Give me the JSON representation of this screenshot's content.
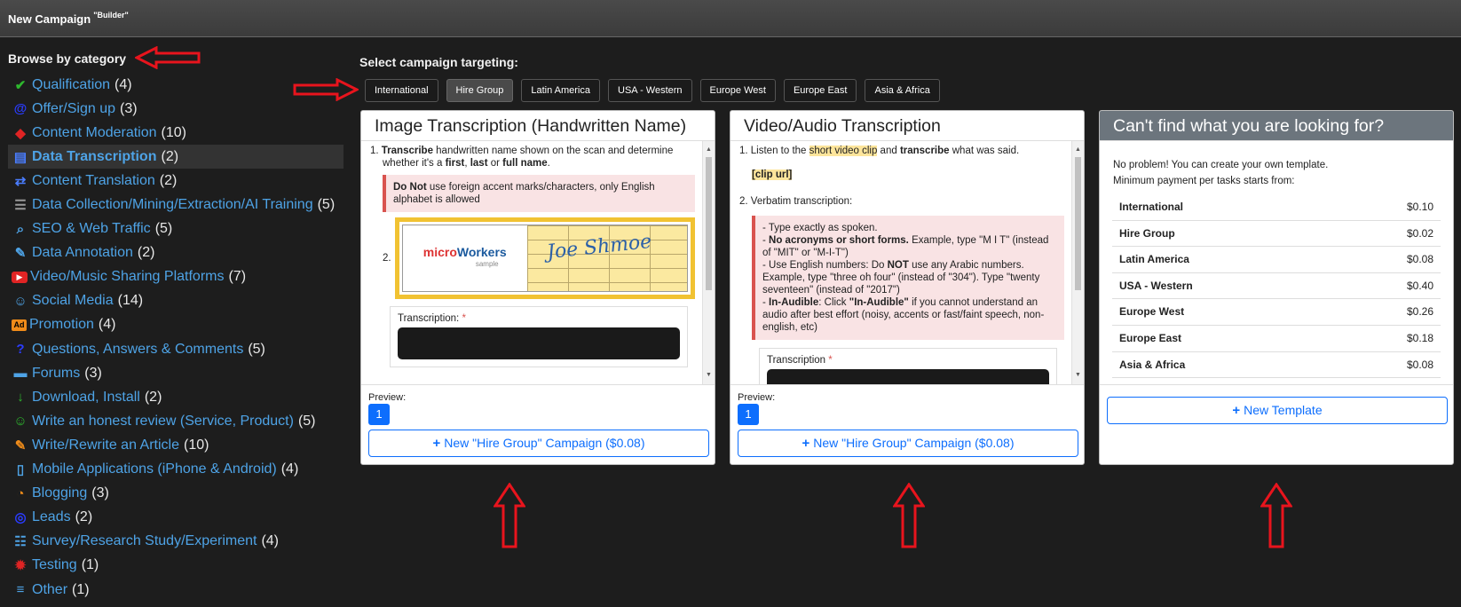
{
  "header": {
    "title": "New Campaign",
    "badge": "\"Builder\""
  },
  "sidebar": {
    "heading": "Browse by category",
    "items": [
      {
        "label": "Qualification",
        "count": "(4)",
        "icon": "user-check-icon",
        "color": "#2eb82e"
      },
      {
        "label": "Offer/Sign up",
        "count": "(3)",
        "icon": "at-sign-icon",
        "color": "#2a3cff"
      },
      {
        "label": "Content Moderation",
        "count": "(10)",
        "icon": "shield-icon",
        "color": "#e02424"
      },
      {
        "label": "Data Transcription",
        "count": "(2)",
        "icon": "file-audio-icon",
        "color": "#4a7dff"
      },
      {
        "label": "Content Translation",
        "count": "(2)",
        "icon": "translate-icon",
        "color": "#4a7dff"
      },
      {
        "label": "Data Collection/Mining/Extraction/AI Training",
        "count": "(5)",
        "icon": "document-icon",
        "color": "#999999"
      },
      {
        "label": "SEO & Web Traffic",
        "count": "(5)",
        "icon": "search-icon",
        "color": "#4ea3e6"
      },
      {
        "label": "Data Annotation",
        "count": "(2)",
        "icon": "edit-note-icon",
        "color": "#4ea3e6"
      },
      {
        "label": "Video/Music Sharing Platforms",
        "count": "(7)",
        "icon": "youtube-icon",
        "color": "#e02424"
      },
      {
        "label": "Social Media",
        "count": "(14)",
        "icon": "users-icon",
        "color": "#4ea3e6"
      },
      {
        "label": "Promotion",
        "count": "(4)",
        "icon": "ad-icon",
        "color": "#f08c1a"
      },
      {
        "label": "Questions, Answers & Comments",
        "count": "(5)",
        "icon": "question-icon",
        "color": "#2a3cff"
      },
      {
        "label": "Forums",
        "count": "(3)",
        "icon": "comments-icon",
        "color": "#4ea3e6"
      },
      {
        "label": "Download, Install",
        "count": "(2)",
        "icon": "download-icon",
        "color": "#2eb82e"
      },
      {
        "label": "Write an honest review (Service, Product)",
        "count": "(5)",
        "icon": "smile-icon",
        "color": "#2eb82e"
      },
      {
        "label": "Write/Rewrite an Article",
        "count": "(10)",
        "icon": "pencil-icon",
        "color": "#f08c1a"
      },
      {
        "label": "Mobile Applications (iPhone & Android)",
        "count": "(4)",
        "icon": "mobile-icon",
        "color": "#4ea3e6"
      },
      {
        "label": "Blogging",
        "count": "(3)",
        "icon": "rss-icon",
        "color": "#f08c1a"
      },
      {
        "label": "Leads",
        "count": "(2)",
        "icon": "globe-icon",
        "color": "#2a3cff"
      },
      {
        "label": "Survey/Research Study/Experiment",
        "count": "(4)",
        "icon": "survey-icon",
        "color": "#4ea3e6"
      },
      {
        "label": "Testing",
        "count": "(1)",
        "icon": "bug-icon",
        "color": "#e02424"
      },
      {
        "label": "Other",
        "count": "(1)",
        "icon": "list-icon",
        "color": "#4ea3e6"
      }
    ]
  },
  "targeting": {
    "label": "Select campaign targeting:",
    "tabs": [
      "International",
      "Hire Group",
      "Latin America",
      "USA - Western",
      "Europe West",
      "Europe East",
      "Asia & Africa"
    ],
    "selected": "Hire Group"
  },
  "card1": {
    "title": "Image Transcription (Handwritten Name)",
    "step1_bold": "Transcribe",
    "step1_text": " handwritten name shown on the scan and determine whether it's a ",
    "first": "first",
    "comma": ", ",
    "last": "last",
    "or": " or ",
    "full": "full name",
    "dot": ".",
    "warn_bold": "Do Not",
    "warn_text": " use foreign accent marks/characters, only English alphabet is allowed",
    "step2_num": "2.",
    "sample_brand_m": "micro",
    "sample_brand_w": "Workers",
    "sample_sub": "sample",
    "signature": "Joe Shmoe",
    "field_label": "Transcription: ",
    "required_mark": "*",
    "preview_label": "Preview:",
    "page": "1",
    "button_label": "New \"Hire Group\" Campaign ($0.08)"
  },
  "card2": {
    "title": "Video/Audio Transcription",
    "s1_a": "1. Listen to the ",
    "s1_hl": "short video clip",
    "s1_b": " and ",
    "s1_bold": "transcribe",
    "s1_c": " what was said.",
    "clip": "[clip url]",
    "s2": "2. Verbatim transcription:",
    "r1": "- Type exactly as spoken.",
    "r2_bold": "No acronyms or short forms.",
    "r2_text": " Example, type \"M I T\" (instead of \"MIT\" or \"M-I-T\")",
    "r3_a": "- Use English numbers: Do ",
    "r3_bold": "NOT",
    "r3_b": " use any Arabic numbers. Example, type \"three oh four\" (instead of \"304\"). Type \"twenty seventeen\" (instead of \"2017\")",
    "r4_bold": "In-Audible",
    "r4_a": ": Click ",
    "r4_bold2": "\"In-Audible\"",
    "r4_b": " if you cannot understand an audio after best effort (noisy, accents or fast/faint speech, non-english, etc)",
    "field_label": "Transcription ",
    "required_mark": "*",
    "preview_label": "Preview:",
    "page": "1",
    "button_label": "New \"Hire Group\" Campaign ($0.08)"
  },
  "card3": {
    "title": "Can't find what you are looking for?",
    "line1": "No problem! You can create your own template.",
    "line2": "Minimum payment per tasks starts from:",
    "prices": [
      {
        "name": "International",
        "price": "$0.10"
      },
      {
        "name": "Hire Group",
        "price": "$0.02"
      },
      {
        "name": "Latin America",
        "price": "$0.08"
      },
      {
        "name": "USA - Western",
        "price": "$0.40"
      },
      {
        "name": "Europe West",
        "price": "$0.26"
      },
      {
        "name": "Europe East",
        "price": "$0.18"
      },
      {
        "name": "Asia & Africa",
        "price": "$0.08"
      }
    ],
    "button_label": "New Template"
  },
  "colors": {
    "accent": "#0d6efd",
    "link": "#4ea3e6",
    "annotation_arrow": "#e8141d"
  }
}
